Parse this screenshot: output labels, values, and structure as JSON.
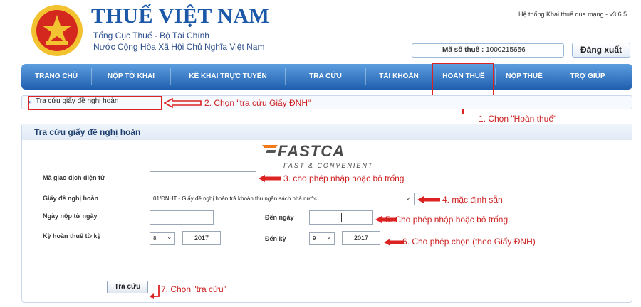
{
  "header": {
    "title": "THUẾ VIỆT NAM",
    "subtitle_line1": "Tổng Cục Thuế - Bộ Tài Chính",
    "subtitle_line2": "Nước Cộng Hòa Xã Hội Chủ Nghĩa Việt Nam",
    "logo_text": "THUẾ NHÀ NƯỚC",
    "system_version": "Hệ thống Khai thuế qua mạng - v3.6.5",
    "tax_code_label": "Mã số thuế :",
    "tax_code_value": "1000215656",
    "logout_label": "Đăng xuất"
  },
  "nav": {
    "items": [
      {
        "label": "TRANG CHỦ"
      },
      {
        "label": "NỘP TỜ KHAI"
      },
      {
        "label": "KÊ KHAI TRỰC TUYẾN"
      },
      {
        "label": "TRA CỨU"
      },
      {
        "label": "TÀI KHOẢN"
      },
      {
        "label": "HOÀN THUẾ"
      },
      {
        "label": "NỘP THUẾ"
      },
      {
        "label": "TRỢ GIÚP"
      }
    ]
  },
  "subnav": {
    "link_label": "Tra cứu giấy đề nghị hoàn"
  },
  "annotations": {
    "step1": "1. Chọn \"Hoàn thuế\"",
    "step2": "2. Chọn \"tra cứu Giấy ĐNH\"",
    "step3": "3. cho phép nhập hoặc bỏ trống",
    "step4": "4. mặc định sẵn",
    "step5": "5. Cho phép nhập hoặc bỏ trống",
    "step6": "6. Cho phép chọn (theo Giấy ĐNH)",
    "step7": "7. Chọn \"tra cứu\""
  },
  "form": {
    "panel_title": "Tra cứu giấy đề nghị hoàn",
    "transaction_code_label": "Mã giao dịch điện tử",
    "transaction_code_value": "",
    "request_form_label": "Giấy đề nghị hoàn",
    "request_form_selected": "01/ĐNHT - Giấy đề nghị hoàn trả khoản thu ngân sách nhà nước",
    "from_date_label": "Ngày nộp từ ngày",
    "from_date_value": "",
    "to_date_label": "Đến ngày",
    "to_date_value": "",
    "period_from_label": "Kỳ hoàn thuế từ kỳ",
    "period_from_month": "8",
    "period_from_year": "2017",
    "period_to_label": "Đến kỳ",
    "period_to_month": "9",
    "period_to_year": "2017",
    "search_button": "Tra cứu"
  },
  "watermark": {
    "name": "FASTCA",
    "tagline": "FAST & CONVENIENT"
  },
  "colors": {
    "brand_blue": "#1b58a8",
    "nav_top": "#5d9ee0",
    "nav_bottom": "#1f5fae",
    "annotation_red": "#cc1f1f",
    "logo_red": "#d4281f",
    "logo_gold": "#f2c230"
  },
  "icons": [
    "emblem-logo",
    "bullet-icon",
    "arrow-left-icon",
    "chevron-down-icon"
  ]
}
